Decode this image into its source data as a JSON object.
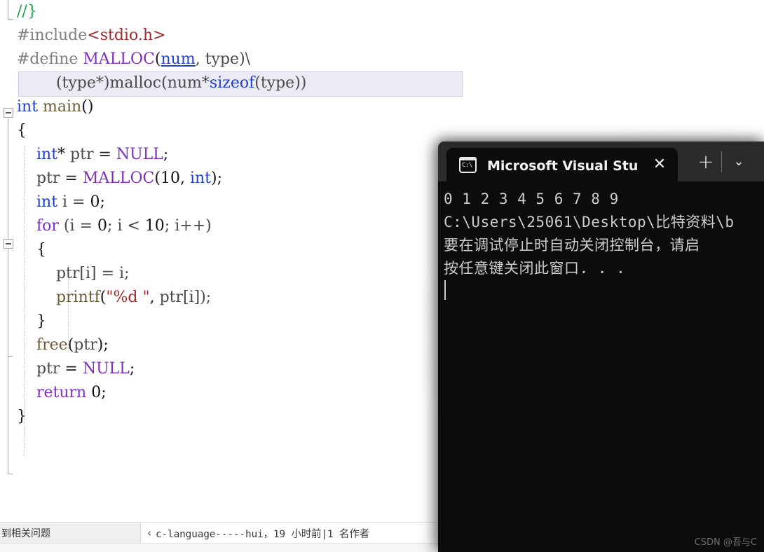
{
  "editor": {
    "name": "Visual Studio C/C++ editor",
    "code_lines": [
      {
        "id": "l1",
        "indent": 0,
        "tokens": [
          {
            "t": "//}",
            "c": "comment"
          }
        ]
      },
      {
        "id": "l2",
        "indent": 0,
        "tokens": [
          {
            "t": "#include",
            "c": "pp"
          },
          {
            "t": "<stdio.h>",
            "c": "string"
          }
        ]
      },
      {
        "id": "l3",
        "indent": 0,
        "tokens": [
          {
            "t": "#define ",
            "c": "pp"
          },
          {
            "t": "MALLOC",
            "c": "keyword"
          },
          {
            "t": "(",
            "c": "plain"
          },
          {
            "t": "num",
            "c": "param"
          },
          {
            "t": ", type)\\",
            "c": "ident"
          }
        ]
      },
      {
        "id": "l4",
        "indent": 0,
        "highlight": true,
        "tokens": [
          {
            "t": "        (type*)",
            "c": "ident"
          },
          {
            "t": "malloc",
            "c": "ident"
          },
          {
            "t": "(num*",
            "c": "ident"
          },
          {
            "t": "sizeof",
            "c": "type"
          },
          {
            "t": "(type))",
            "c": "ident"
          }
        ]
      },
      {
        "id": "l5",
        "indent": 0,
        "tokens": [
          {
            "t": "int",
            "c": "type"
          },
          {
            "t": " ",
            "c": "plain"
          },
          {
            "t": "main",
            "c": "func"
          },
          {
            "t": "()",
            "c": "plain"
          }
        ]
      },
      {
        "id": "l6",
        "indent": 0,
        "tokens": [
          {
            "t": "{",
            "c": "plain"
          }
        ]
      },
      {
        "id": "l7",
        "indent": 0,
        "tokens": [
          {
            "t": "    ",
            "c": "plain"
          },
          {
            "t": "int",
            "c": "type"
          },
          {
            "t": "* ",
            "c": "plain"
          },
          {
            "t": "ptr",
            "c": "ident"
          },
          {
            "t": " = ",
            "c": "plain"
          },
          {
            "t": "NULL",
            "c": "keyword"
          },
          {
            "t": ";",
            "c": "plain"
          }
        ]
      },
      {
        "id": "l8",
        "indent": 0,
        "tokens": [
          {
            "t": "    ",
            "c": "plain"
          },
          {
            "t": "ptr",
            "c": "ident"
          },
          {
            "t": " = ",
            "c": "plain"
          },
          {
            "t": "MALLOC",
            "c": "keyword"
          },
          {
            "t": "(",
            "c": "plain"
          },
          {
            "t": "10",
            "c": "num"
          },
          {
            "t": ", ",
            "c": "plain"
          },
          {
            "t": "int",
            "c": "type"
          },
          {
            "t": ");",
            "c": "plain"
          }
        ]
      },
      {
        "id": "l9",
        "indent": 0,
        "tokens": [
          {
            "t": "    ",
            "c": "plain"
          },
          {
            "t": "int",
            "c": "type"
          },
          {
            "t": " i = ",
            "c": "ident"
          },
          {
            "t": "0",
            "c": "num"
          },
          {
            "t": ";",
            "c": "plain"
          }
        ]
      },
      {
        "id": "l10",
        "indent": 0,
        "tokens": [
          {
            "t": "    ",
            "c": "plain"
          },
          {
            "t": "for",
            "c": "keyword"
          },
          {
            "t": " (i = ",
            "c": "ident"
          },
          {
            "t": "0",
            "c": "num"
          },
          {
            "t": "; i < ",
            "c": "ident"
          },
          {
            "t": "10",
            "c": "num"
          },
          {
            "t": "; i++)",
            "c": "ident"
          }
        ]
      },
      {
        "id": "l11",
        "indent": 0,
        "tokens": [
          {
            "t": "    {",
            "c": "plain"
          }
        ]
      },
      {
        "id": "l12",
        "indent": 0,
        "tokens": [
          {
            "t": "        ",
            "c": "plain"
          },
          {
            "t": "ptr",
            "c": "ident"
          },
          {
            "t": "[i] = i;",
            "c": "ident"
          }
        ]
      },
      {
        "id": "l13",
        "indent": 0,
        "tokens": [
          {
            "t": "        ",
            "c": "plain"
          },
          {
            "t": "printf",
            "c": "func"
          },
          {
            "t": "(",
            "c": "plain"
          },
          {
            "t": "\"%d \"",
            "c": "string"
          },
          {
            "t": ", ",
            "c": "plain"
          },
          {
            "t": "ptr",
            "c": "ident"
          },
          {
            "t": "[i]);",
            "c": "ident"
          }
        ]
      },
      {
        "id": "l14",
        "indent": 0,
        "tokens": [
          {
            "t": "    }",
            "c": "plain"
          }
        ]
      },
      {
        "id": "l15",
        "indent": 0,
        "tokens": [
          {
            "t": "    ",
            "c": "plain"
          },
          {
            "t": "free",
            "c": "func"
          },
          {
            "t": "(",
            "c": "plain"
          },
          {
            "t": "ptr",
            "c": "ident"
          },
          {
            "t": ");",
            "c": "plain"
          }
        ]
      },
      {
        "id": "l16",
        "indent": 0,
        "tokens": [
          {
            "t": "    ",
            "c": "plain"
          },
          {
            "t": "ptr",
            "c": "ident"
          },
          {
            "t": " = ",
            "c": "plain"
          },
          {
            "t": "NULL",
            "c": "keyword"
          },
          {
            "t": ";",
            "c": "plain"
          }
        ]
      },
      {
        "id": "l17",
        "indent": 0,
        "tokens": [
          {
            "t": "    ",
            "c": "plain"
          },
          {
            "t": "return",
            "c": "keyword"
          },
          {
            "t": " ",
            "c": "plain"
          },
          {
            "t": "0",
            "c": "num"
          },
          {
            "t": ";",
            "c": "plain"
          }
        ]
      },
      {
        "id": "l18",
        "indent": 0,
        "tokens": [
          {
            "t": "}",
            "c": "plain"
          }
        ]
      }
    ]
  },
  "status_bar": {
    "left_text": "到相关问题",
    "chevron_icon": "‹",
    "annotation": "c-language-----hui，19 小时前|1 名作者"
  },
  "console": {
    "tab": {
      "icon": "terminal-icon",
      "icon_label": "C:\\",
      "title": "Microsoft Visual Studio 调试控",
      "close_icon": "✕"
    },
    "new_tab_icon": "+",
    "dropdown_icon": "⌄",
    "output_lines": [
      "0 1 2 3 4 5 6 7 8 9",
      "C:\\Users\\25061\\Desktop\\比特资料\\b",
      "要在调试停止时自动关闭控制台，请启",
      "按任意键关闭此窗口. . ."
    ]
  },
  "watermark": {
    "text": "CSDN @吾与C"
  },
  "colors": {
    "keyword": "#7f2fbf",
    "type": "#1f3fd0",
    "comment": "#1f9e4a",
    "string": "#9c2b2b",
    "function": "#6b5d3a",
    "console_bg": "#0c0c0c",
    "console_titlebar": "#2b2b2b",
    "highlight": "#eceaf4"
  }
}
